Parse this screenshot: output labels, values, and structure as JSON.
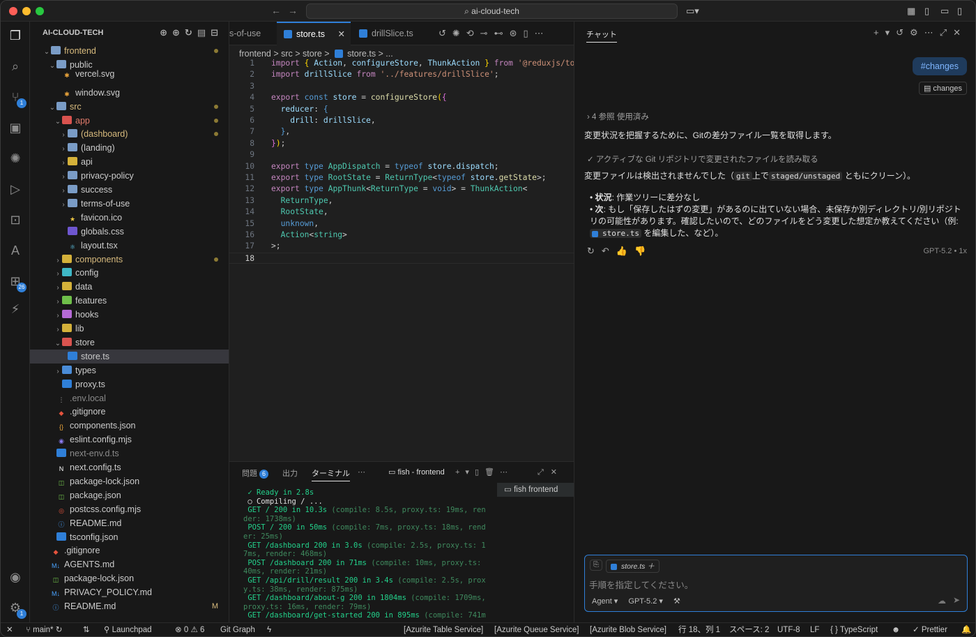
{
  "window": {
    "search": "ai-cloud-tech"
  },
  "activity": {
    "scm_badge": "1",
    "ext_badge": "26",
    "settings_badge": "1"
  },
  "explorer": {
    "title": "AI-CLOUD-TECH",
    "items": [
      {
        "label": "frontend",
        "chev": "v",
        "indent": 0,
        "icon": "folder",
        "dot": true
      },
      {
        "label": "public",
        "chev": "v",
        "indent": 1,
        "icon": "folder",
        "dot": false
      },
      {
        "label": "vercel.svg",
        "chev": "",
        "indent": 2,
        "icon": "svg",
        "dot": false
      },
      {
        "label": "window.svg",
        "chev": "",
        "indent": 2,
        "icon": "svg",
        "dot": false
      },
      {
        "label": "src",
        "chev": "v",
        "indent": 1,
        "icon": "folder",
        "dot": true
      },
      {
        "label": "app",
        "chev": "v",
        "indent": 2,
        "icon": "folder-red",
        "dot": true
      },
      {
        "label": "(dashboard)",
        "chev": ">",
        "indent": 3,
        "icon": "folder",
        "dot": true
      },
      {
        "label": "(landing)",
        "chev": ">",
        "indent": 3,
        "icon": "folder",
        "dot": false
      },
      {
        "label": "api",
        "chev": ">",
        "indent": 3,
        "icon": "folder-yellow",
        "dot": false
      },
      {
        "label": "privacy-policy",
        "chev": ">",
        "indent": 3,
        "icon": "folder",
        "dot": false
      },
      {
        "label": "success",
        "chev": ">",
        "indent": 3,
        "icon": "folder",
        "dot": false
      },
      {
        "label": "terms-of-use",
        "chev": ">",
        "indent": 3,
        "icon": "folder",
        "dot": false
      },
      {
        "label": "favicon.ico",
        "chev": "",
        "indent": 3,
        "icon": "star",
        "dot": false
      },
      {
        "label": "globals.css",
        "chev": "",
        "indent": 3,
        "icon": "css",
        "dot": false
      },
      {
        "label": "layout.tsx",
        "chev": "",
        "indent": 3,
        "icon": "react",
        "dot": false
      },
      {
        "label": "components",
        "chev": ">",
        "indent": 2,
        "icon": "folder-yellow",
        "dot": true
      },
      {
        "label": "config",
        "chev": ">",
        "indent": 2,
        "icon": "folder-teal",
        "dot": false
      },
      {
        "label": "data",
        "chev": ">",
        "indent": 2,
        "icon": "folder-yellow",
        "dot": false
      },
      {
        "label": "features",
        "chev": ">",
        "indent": 2,
        "icon": "folder-green",
        "dot": false
      },
      {
        "label": "hooks",
        "chev": ">",
        "indent": 2,
        "icon": "folder-purple",
        "dot": false
      },
      {
        "label": "lib",
        "chev": ">",
        "indent": 2,
        "icon": "folder-yellow",
        "dot": false
      },
      {
        "label": "store",
        "chev": "v",
        "indent": 2,
        "icon": "folder-red",
        "dot": false
      },
      {
        "label": "store.ts",
        "chev": "",
        "indent": 3,
        "icon": "ts",
        "dot": false,
        "selected": true
      },
      {
        "label": "types",
        "chev": ">",
        "indent": 2,
        "icon": "folder-blue",
        "dot": false
      },
      {
        "label": "proxy.ts",
        "chev": "",
        "indent": 2,
        "icon": "ts",
        "dot": false
      },
      {
        "label": ".env.local",
        "chev": "",
        "indent": 1,
        "icon": "env",
        "dot": false,
        "dim": true
      },
      {
        "label": ".gitignore",
        "chev": "",
        "indent": 1,
        "icon": "git",
        "dot": false
      },
      {
        "label": "components.json",
        "chev": "",
        "indent": 1,
        "icon": "json",
        "dot": false
      },
      {
        "label": "eslint.config.mjs",
        "chev": "",
        "indent": 1,
        "icon": "eslint",
        "dot": false
      },
      {
        "label": "next-env.d.ts",
        "chev": "",
        "indent": 1,
        "icon": "ts",
        "dot": false,
        "dim": true
      },
      {
        "label": "next.config.ts",
        "chev": "",
        "indent": 1,
        "icon": "next",
        "dot": false
      },
      {
        "label": "package-lock.json",
        "chev": "",
        "indent": 1,
        "icon": "npm",
        "dot": false
      },
      {
        "label": "package.json",
        "chev": "",
        "indent": 1,
        "icon": "npm",
        "dot": false
      },
      {
        "label": "postcss.config.mjs",
        "chev": "",
        "indent": 1,
        "icon": "postcss",
        "dot": false
      },
      {
        "label": "README.md",
        "chev": "",
        "indent": 1,
        "icon": "info",
        "dot": false
      },
      {
        "label": "tsconfig.json",
        "chev": "",
        "indent": 1,
        "icon": "tsconfig",
        "dot": false
      },
      {
        "label": ".gitignore",
        "chev": "",
        "indent": 0,
        "icon": "git",
        "dot": false
      },
      {
        "label": "AGENTS.md",
        "chev": "",
        "indent": 0,
        "icon": "md",
        "dot": false
      },
      {
        "label": "package-lock.json",
        "chev": "",
        "indent": 0,
        "icon": "npm",
        "dot": false
      },
      {
        "label": "PRIVACY_POLICY.md",
        "chev": "",
        "indent": 0,
        "icon": "md",
        "dot": false
      },
      {
        "label": "README.md",
        "chev": "",
        "indent": 0,
        "icon": "info",
        "dot": false,
        "mflag": "M"
      }
    ]
  },
  "editor": {
    "tabs": [
      {
        "label": "s-of-use",
        "active": false,
        "icon": false
      },
      {
        "label": "store.ts",
        "active": true,
        "icon": true
      },
      {
        "label": "drillSlice.ts",
        "active": false,
        "icon": true
      }
    ],
    "breadcrumb": "frontend  >  src  >  store  >",
    "breadcrumb_file": "store.ts  >  ...",
    "current_line": 18
  },
  "panel": {
    "tab_problems": "問題",
    "problems_count": "6",
    "tab_output": "出力",
    "tab_terminal": "ターミナル",
    "terminal_name": "fish - frontend",
    "terminal_list_item": "fish  frontend",
    "lines": [
      {
        "main": " ✓ Ready in 2.8s",
        "dim": ""
      },
      {
        "main": " ○ Compiling / ...",
        "dim": "",
        "white": true
      },
      {
        "main": " GET / 200 in 10.3s",
        "dim": " (compile: 8.5s, proxy.ts: 19ms, ren"
      },
      {
        "main": "",
        "dim": "der: 1738ms)"
      },
      {
        "main": " POST / 200 in 50ms",
        "dim": " (compile: 7ms, proxy.ts: 18ms, rend"
      },
      {
        "main": "",
        "dim": "er: 25ms)"
      },
      {
        "main": " GET /dashboard 200 in 3.0s",
        "dim": " (compile: 2.5s, proxy.ts: 1"
      },
      {
        "main": "",
        "dim": "7ms, render: 468ms)"
      },
      {
        "main": " POST /dashboard 200 in 71ms",
        "dim": " (compile: 10ms, proxy.ts:"
      },
      {
        "main": "",
        "dim": "40ms, render: 21ms)"
      },
      {
        "main": " GET /api/drill/result 200 in 3.4s",
        "dim": " (compile: 2.5s, prox"
      },
      {
        "main": "",
        "dim": "y.ts: 38ms, render: 875ms)"
      },
      {
        "main": " GET /dashboard/about-g 200 in 1804ms",
        "dim": " (compile: 1709ms,"
      },
      {
        "main": "",
        "dim": "proxy.ts: 16ms, render: 79ms)"
      },
      {
        "main": " GET /dashboard/get-started 200 in 895ms",
        "dim": " (compile: 741m"
      }
    ]
  },
  "chat": {
    "title": "チャット",
    "user_message": "#changes",
    "user_chip": "changes",
    "refs": "4 参照 使用済み",
    "intro": "変更状況を把握するために、Gitの差分ファイル一覧を取得します。",
    "tool_call": "アクティブな Git リポジトリで変更されたファイルを読み取る",
    "result_pre": "変更ファイルは検出されませんでした（",
    "result_code1": "git",
    "result_mid": "上で",
    "result_code2": "staged/unstaged",
    "result_post": "ともにクリーン）。",
    "bullet1_label": "状況",
    "bullet1_text": ": 作業ツリーに差分なし",
    "bullet2_label": "次",
    "bullet2_text": ": もし「保存したはずの変更」があるのに出ていない場合、未保存か別ディレクトリ/別リポジトリの可能性があります。確認したいので、どのファイルをどう変更した想定か教えてください（例:",
    "bullet2_file": "store.ts",
    "bullet2_tail": "を編集した、など）。",
    "model_tag": "GPT-5.2 • 1x",
    "ctx_file": "store.ts",
    "placeholder": "手順を指定してください。",
    "mode": "Agent",
    "model": "GPT-5.2"
  },
  "statusbar": {
    "branch": "main*",
    "launchpad": "Launchpad",
    "errors": "0",
    "warnings": "6",
    "gitgraph": "Git Graph",
    "azure_table": "[Azurite Table Service]",
    "azure_queue": "[Azurite Queue Service]",
    "azure_blob": "[Azurite Blob Service]",
    "position": "行 18、列 1",
    "spaces": "スペース: 2",
    "encoding": "UTF-8",
    "eol": "LF",
    "language": "TypeScript",
    "prettier": "Prettier"
  },
  "colors": {
    "accent": "#2f7fd8",
    "terminal_green": "#23d18b"
  }
}
